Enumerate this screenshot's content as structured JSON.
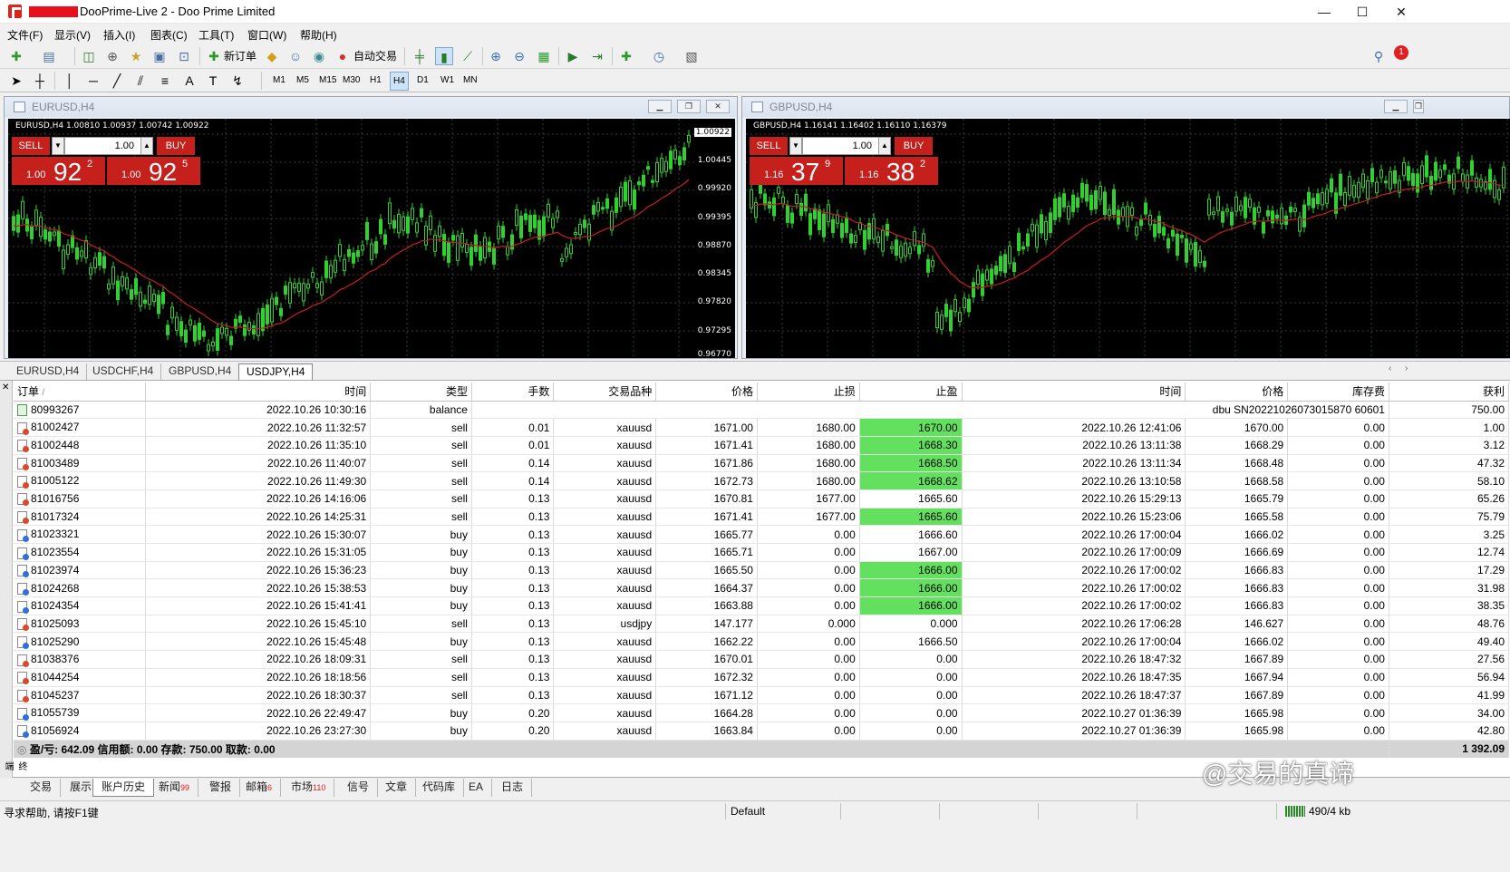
{
  "window": {
    "title": "DooPrime-Live 2 - Doo Prime Limited",
    "minimize": "—",
    "maximize": "☐",
    "close": "✕"
  },
  "menu": [
    "文件(F)",
    "显示(V)",
    "插入(I)",
    "图表(C)",
    "工具(T)",
    "窗口(W)",
    "帮助(H)"
  ],
  "toolbar": {
    "new_order": "新订单",
    "auto_trade": "自动交易",
    "timeframes": [
      "M1",
      "M5",
      "M15",
      "M30",
      "H1",
      "H4",
      "D1",
      "W1",
      "MN"
    ],
    "active_timeframe": "H4",
    "alert_count": "1"
  },
  "charts": [
    {
      "title": "EURUSD,H4",
      "info": "EURUSD,H4  1.00810 1.00937 1.00742 1.00922",
      "sell_label": "SELL",
      "buy_label": "BUY",
      "lot": "1.00",
      "sell_price": {
        "small": "1.00",
        "big": "92",
        "sup": "2"
      },
      "buy_price": {
        "small": "1.00",
        "big": "92",
        "sup": "5"
      },
      "y_labels": [
        "1.00922",
        "1.00445",
        "0.99920",
        "0.99395",
        "0.98870",
        "0.98345",
        "0.97820",
        "0.97295",
        "0.96770"
      ],
      "current": "1.00922"
    },
    {
      "title": "GBPUSD,H4",
      "info": "GBPUSD,H4  1.16141 1.16402 1.16110 1.16379",
      "sell_label": "SELL",
      "buy_label": "BUY",
      "lot": "1.00",
      "sell_price": {
        "small": "1.16",
        "big": "37",
        "sup": "9"
      },
      "buy_price": {
        "small": "1.16",
        "big": "38",
        "sup": "2"
      }
    }
  ],
  "chart_tabs": [
    "EURUSD,H4",
    "USDCHF,H4",
    "GBPUSD,H4",
    "USDJPY,H4"
  ],
  "active_chart_tab": "USDJPY,H4",
  "history": {
    "columns": [
      "订单",
      "时间",
      "类型",
      "手数",
      "交易品种",
      "价格",
      "止损",
      "止盈",
      "时间",
      "价格",
      "库存费",
      "获利"
    ],
    "sort_indicator": "/",
    "balance_row": {
      "order": "80993267",
      "time": "2022.10.26 10:30:16",
      "type": "balance",
      "comment": "dbu SN20221026073015870 60601",
      "profit": "750.00"
    },
    "rows": [
      [
        "81002427",
        "2022.10.26 11:32:57",
        "sell",
        "0.01",
        "xauusd",
        "1671.00",
        "1680.00",
        "1670.00",
        "2022.10.26 12:41:06",
        "1670.00",
        "0.00",
        "1.00"
      ],
      [
        "81002448",
        "2022.10.26 11:35:10",
        "sell",
        "0.01",
        "xauusd",
        "1671.41",
        "1680.00",
        "1668.30",
        "2022.10.26 13:11:38",
        "1668.29",
        "0.00",
        "3.12"
      ],
      [
        "81003489",
        "2022.10.26 11:40:07",
        "sell",
        "0.14",
        "xauusd",
        "1671.86",
        "1680.00",
        "1668.50",
        "2022.10.26 13:11:34",
        "1668.48",
        "0.00",
        "47.32"
      ],
      [
        "81005122",
        "2022.10.26 11:49:30",
        "sell",
        "0.14",
        "xauusd",
        "1672.73",
        "1680.00",
        "1668.62",
        "2022.10.26 13:10:58",
        "1668.58",
        "0.00",
        "58.10"
      ],
      [
        "81016756",
        "2022.10.26 14:16:06",
        "sell",
        "0.13",
        "xauusd",
        "1670.81",
        "1677.00",
        "1665.60",
        "2022.10.26 15:29:13",
        "1665.79",
        "0.00",
        "65.26"
      ],
      [
        "81017324",
        "2022.10.26 14:25:31",
        "sell",
        "0.13",
        "xauusd",
        "1671.41",
        "1677.00",
        "1665.60",
        "2022.10.26 15:23:06",
        "1665.58",
        "0.00",
        "75.79"
      ],
      [
        "81023321",
        "2022.10.26 15:30:07",
        "buy",
        "0.13",
        "xauusd",
        "1665.77",
        "0.00",
        "1666.60",
        "2022.10.26 17:00:04",
        "1666.02",
        "0.00",
        "3.25"
      ],
      [
        "81023554",
        "2022.10.26 15:31:05",
        "buy",
        "0.13",
        "xauusd",
        "1665.71",
        "0.00",
        "1667.00",
        "2022.10.26 17:00:09",
        "1666.69",
        "0.00",
        "12.74"
      ],
      [
        "81023974",
        "2022.10.26 15:36:23",
        "buy",
        "0.13",
        "xauusd",
        "1665.50",
        "0.00",
        "1666.00",
        "2022.10.26 17:00:02",
        "1666.83",
        "0.00",
        "17.29"
      ],
      [
        "81024268",
        "2022.10.26 15:38:53",
        "buy",
        "0.13",
        "xauusd",
        "1664.37",
        "0.00",
        "1666.00",
        "2022.10.26 17:00:02",
        "1666.83",
        "0.00",
        "31.98"
      ],
      [
        "81024354",
        "2022.10.26 15:41:41",
        "buy",
        "0.13",
        "xauusd",
        "1663.88",
        "0.00",
        "1666.00",
        "2022.10.26 17:00:02",
        "1666.83",
        "0.00",
        "38.35"
      ],
      [
        "81025093",
        "2022.10.26 15:45:10",
        "sell",
        "0.13",
        "usdjpy",
        "147.177",
        "0.000",
        "0.000",
        "2022.10.26 17:06:28",
        "146.627",
        "0.00",
        "48.76"
      ],
      [
        "81025290",
        "2022.10.26 15:45:48",
        "buy",
        "0.13",
        "xauusd",
        "1662.22",
        "0.00",
        "1666.50",
        "2022.10.26 17:00:04",
        "1666.02",
        "0.00",
        "49.40"
      ],
      [
        "81038376",
        "2022.10.26 18:09:31",
        "sell",
        "0.13",
        "xauusd",
        "1670.01",
        "0.00",
        "0.00",
        "2022.10.26 18:47:32",
        "1667.89",
        "0.00",
        "27.56"
      ],
      [
        "81044254",
        "2022.10.26 18:18:56",
        "sell",
        "0.13",
        "xauusd",
        "1672.32",
        "0.00",
        "0.00",
        "2022.10.26 18:47:35",
        "1667.94",
        "0.00",
        "56.94"
      ],
      [
        "81045237",
        "2022.10.26 18:30:37",
        "sell",
        "0.13",
        "xauusd",
        "1671.12",
        "0.00",
        "0.00",
        "2022.10.26 18:47:37",
        "1667.89",
        "0.00",
        "41.99"
      ],
      [
        "81055739",
        "2022.10.26 22:49:47",
        "buy",
        "0.20",
        "xauusd",
        "1664.28",
        "0.00",
        "0.00",
        "2022.10.27 01:36:39",
        "1665.98",
        "0.00",
        "34.00"
      ],
      [
        "81056924",
        "2022.10.26 23:27:30",
        "buy",
        "0.20",
        "xauusd",
        "1663.84",
        "0.00",
        "0.00",
        "2022.10.27 01:36:39",
        "1665.98",
        "0.00",
        "42.80"
      ]
    ],
    "highlight_tp_rows": [
      0,
      1,
      2,
      3,
      5,
      8,
      9,
      10
    ],
    "summary": "盈/亏: 642.09  信用额: 0.00  存款: 750.00  取款: 0.00",
    "summary_total": "1 392.09",
    "highlight_color": "#64e05f"
  },
  "bottom_tabs": [
    {
      "label": "交易",
      "badge": ""
    },
    {
      "label": "展示",
      "badge": ""
    },
    {
      "label": "账户历史",
      "badge": ""
    },
    {
      "label": "新闻",
      "badge": "99"
    },
    {
      "label": "警报",
      "badge": ""
    },
    {
      "label": "邮箱",
      "badge": "6"
    },
    {
      "label": "市场",
      "badge": "110"
    },
    {
      "label": "信号",
      "badge": ""
    },
    {
      "label": "文章",
      "badge": ""
    },
    {
      "label": "代码库",
      "badge": ""
    },
    {
      "label": "EA",
      "badge": ""
    },
    {
      "label": "日志",
      "badge": ""
    }
  ],
  "active_bottom_tab": "账户历史",
  "terminal_side_label": "终端",
  "status": {
    "help": "寻求帮助, 请按F1键",
    "profile": "Default",
    "traffic": "490/4 kb"
  },
  "watermark": "@交易的真谛"
}
